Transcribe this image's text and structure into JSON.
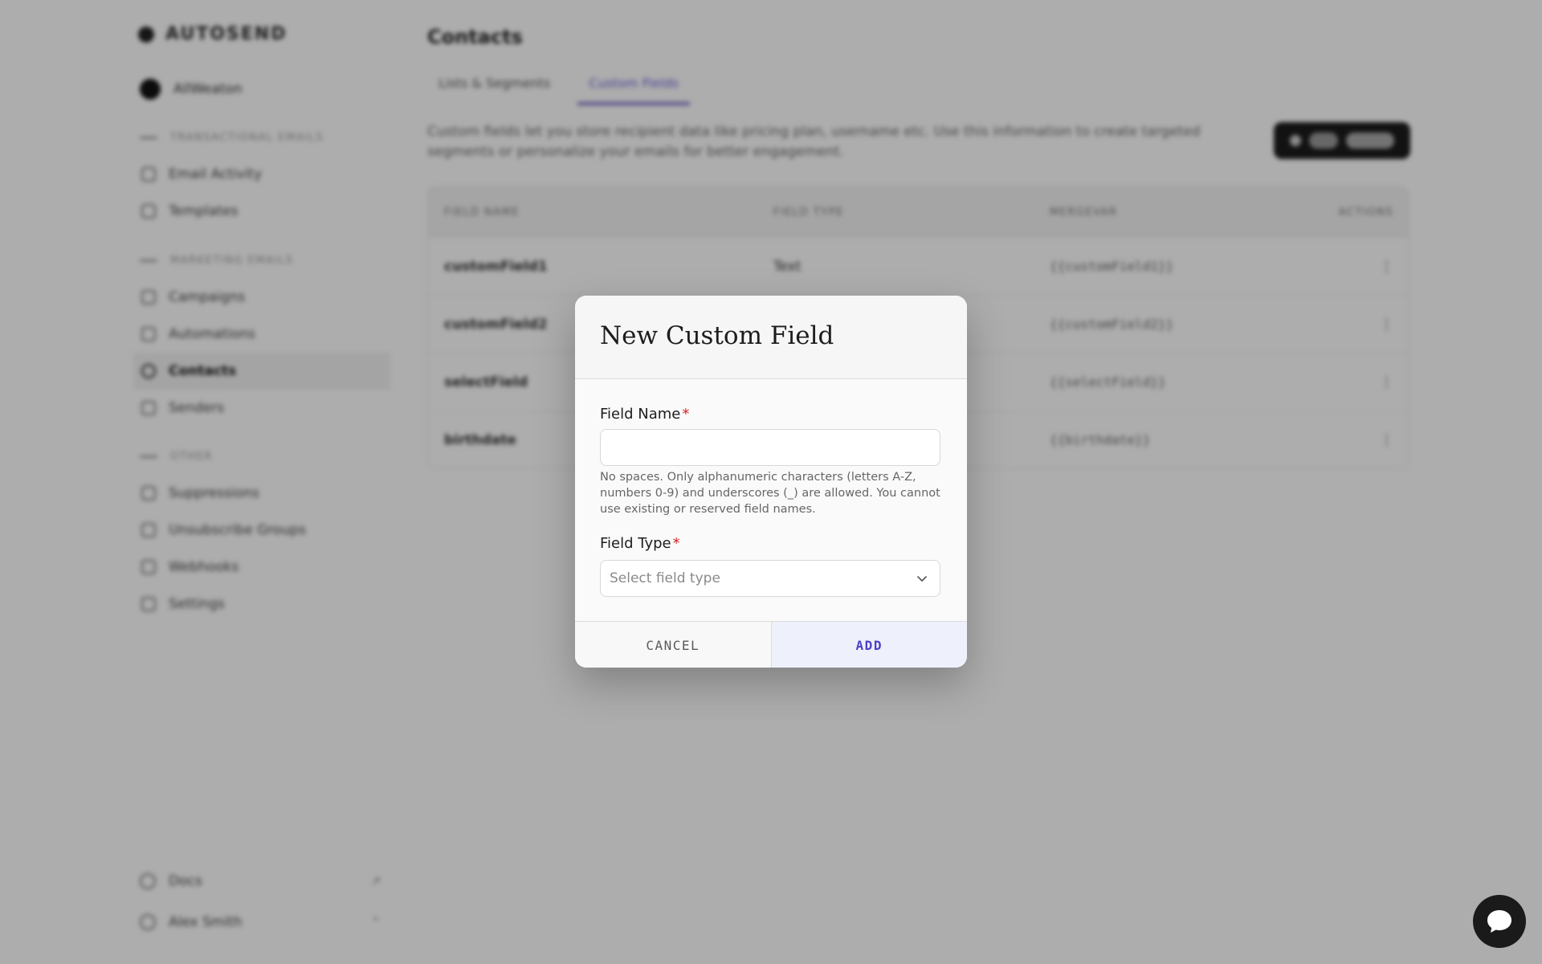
{
  "brand": {
    "name": "AUTOSEND"
  },
  "sidebar": {
    "workspace": "AllWeaton",
    "sections": [
      {
        "title": "TRANSACTIONAL EMAILS",
        "items": [
          {
            "label": "Email Activity",
            "icon": "activity-icon"
          },
          {
            "label": "Templates",
            "icon": "template-icon"
          }
        ]
      },
      {
        "title": "MARKETING EMAILS",
        "items": [
          {
            "label": "Campaigns",
            "icon": "campaign-icon"
          },
          {
            "label": "Automations",
            "icon": "automation-icon"
          },
          {
            "label": "Contacts",
            "icon": "contacts-icon",
            "active": true
          },
          {
            "label": "Senders",
            "icon": "senders-icon"
          }
        ]
      },
      {
        "title": "OTHER",
        "items": [
          {
            "label": "Suppressions",
            "icon": "suppression-icon"
          },
          {
            "label": "Unsubscribe Groups",
            "icon": "unsubscribe-icon"
          },
          {
            "label": "Webhooks",
            "icon": "webhook-icon"
          },
          {
            "label": "Settings",
            "icon": "settings-icon"
          }
        ]
      }
    ],
    "footer": [
      {
        "label": "Docs",
        "icon": "docs-icon"
      },
      {
        "label": "Alex Smith",
        "icon": "user-icon"
      }
    ]
  },
  "main": {
    "title": "Contacts",
    "tabs": [
      {
        "label": "Lists & Segments",
        "active": false
      },
      {
        "label": "Custom Fields",
        "active": true
      }
    ],
    "intro": "Custom fields let you store recipient data like pricing plan, username etc. Use this information to create targeted segments or personalize your emails for better engagement.",
    "add_button": "+ Add Field",
    "table": {
      "columns": [
        "FIELD NAME",
        "FIELD TYPE",
        "MERGEVAR",
        "ACTIONS"
      ],
      "rows": [
        {
          "name": "customField1",
          "type": "Text",
          "merge": "{{customField1}}",
          "action": "⋮"
        },
        {
          "name": "customField2",
          "type": "",
          "merge": "{{customField2}}",
          "action": "⋮"
        },
        {
          "name": "selectField",
          "type": "",
          "merge": "{{selectField}}",
          "action": "⋮"
        },
        {
          "name": "birthdate",
          "type": "",
          "merge": "{{birthdate}}",
          "action": "⋮"
        }
      ]
    }
  },
  "modal": {
    "title": "New Custom Field",
    "field_name": {
      "label": "Field Name",
      "required_mark": "*",
      "value": "",
      "help": "No spaces. Only alphanumeric characters (letters A-Z, numbers 0-9) and underscores (_) are allowed. You cannot use existing or reserved field names."
    },
    "field_type": {
      "label": "Field Type",
      "required_mark": "*",
      "placeholder": "Select field type"
    },
    "cancel_label": "CANCEL",
    "add_label": "ADD"
  },
  "colors": {
    "accent": "#4b3fc7",
    "required": "#d61f1f",
    "overlay": "rgba(0,0,0,0.32)"
  }
}
